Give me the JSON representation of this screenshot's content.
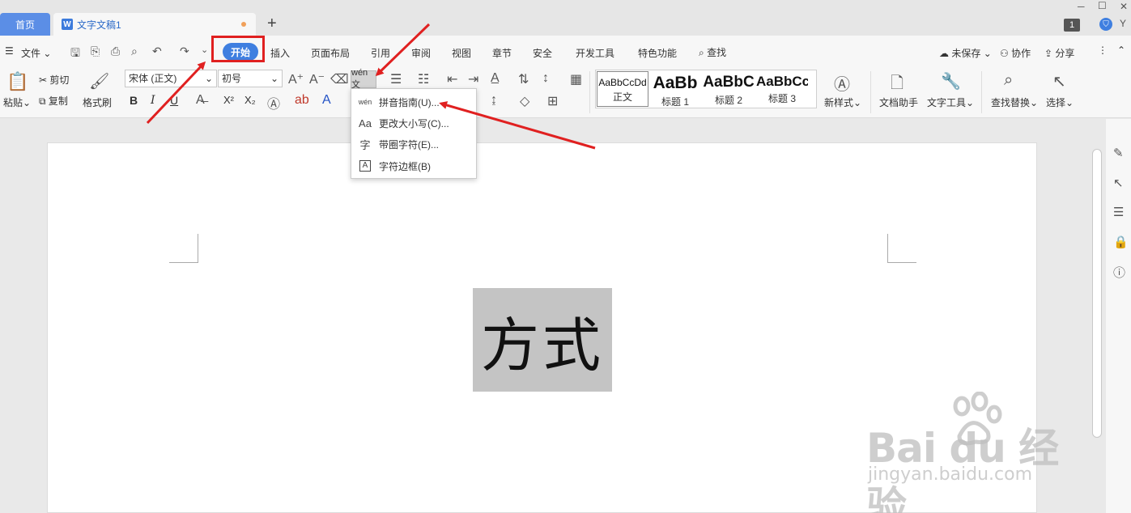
{
  "tabs": {
    "home": "首页",
    "doc": "文字文稿1",
    "doc_icon": "W",
    "add": "+"
  },
  "window": {
    "min": "─",
    "max": "☐",
    "close": "✕",
    "badge": "1",
    "user": "Y"
  },
  "menu": {
    "file": "文件",
    "start": "开始",
    "insert": "插入",
    "layout": "页面布局",
    "reference": "引用",
    "review": "审阅",
    "view": "视图",
    "chapter": "章节",
    "security": "安全",
    "devtools": "开发工具",
    "special": "特色功能",
    "search": "查找",
    "unsaved": "未保存",
    "collab": "协作",
    "share": "分享"
  },
  "ribbon": {
    "paste": "粘贴",
    "cut": "剪切",
    "copy": "复制",
    "format_painter": "格式刷",
    "font_name": "宋体 (正文)",
    "font_size": "初号",
    "phonetic_btn": "wén文",
    "new_style": "新样式",
    "doc_helper": "文档助手",
    "text_tools": "文字工具",
    "find_replace": "查找替换",
    "select": "选择",
    "bold": "B",
    "italic": "I",
    "underline": "U",
    "sup": "X²",
    "sub": "X₂"
  },
  "styles": [
    {
      "sample": "AaBbCcDd",
      "label": "正文"
    },
    {
      "sample": "AaBb",
      "label": "标题 1"
    },
    {
      "sample": "AaBbC",
      "label": "标题 2"
    },
    {
      "sample": "AaBbCc",
      "label": "标题 3"
    }
  ],
  "dropdown": [
    {
      "icon": "wén",
      "label": "拼音指南(U)..."
    },
    {
      "icon": "Aa",
      "label": "更改大小写(C)..."
    },
    {
      "icon": "字",
      "label": "带圈字符(E)..."
    },
    {
      "icon": "A",
      "label": "字符边框(B)"
    }
  ],
  "document": {
    "selected_text": "方式"
  },
  "watermark": {
    "main": "Bai du 经验",
    "sub": "jingyan.baidu.com"
  },
  "colors": {
    "accent": "#3f7fe0",
    "highlight_box": "#e02020",
    "selection": "#c4c4c4"
  }
}
